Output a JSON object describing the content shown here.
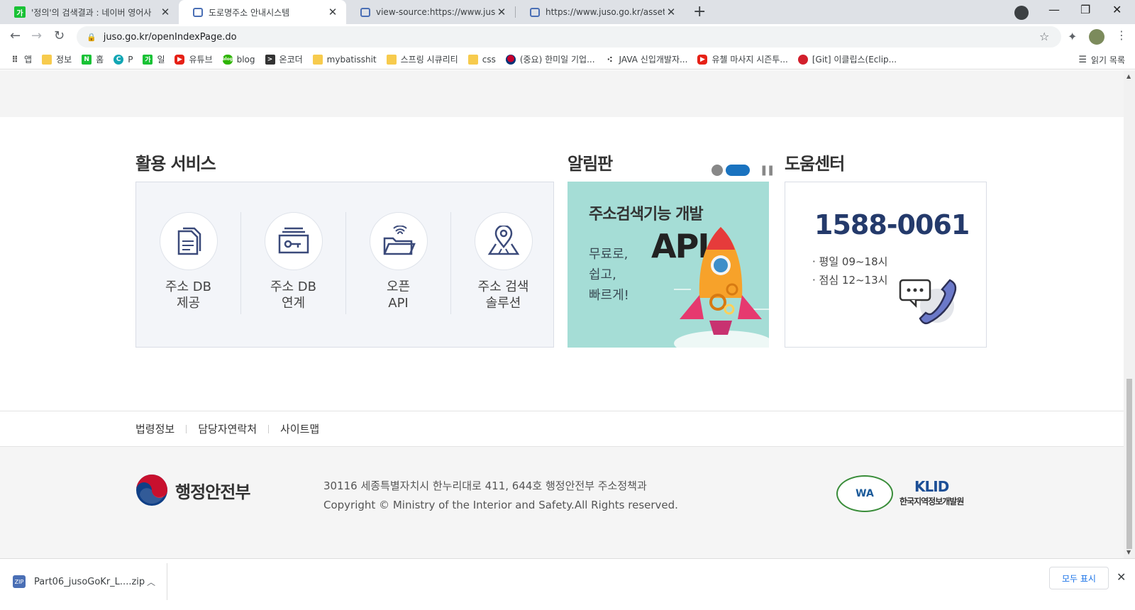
{
  "browser": {
    "tabs": [
      {
        "title": "'정의'의 검색결과 : 네이버 영어사",
        "favicon": "naver-icon",
        "active": false
      },
      {
        "title": "도로명주소 안내시스템",
        "favicon": "page-icon",
        "active": true
      },
      {
        "title": "view-source:https://www.juso.go",
        "favicon": "page-icon",
        "active": false
      },
      {
        "title": "https://www.juso.go.kr/assets/cs",
        "favicon": "page-icon",
        "active": false
      }
    ],
    "url": "juso.go.kr/openIndexPage.do",
    "bookmarks": [
      {
        "label": "앱",
        "icon": "apps-grid-icon"
      },
      {
        "label": "정보",
        "icon": "folder-icon"
      },
      {
        "label": "홈",
        "icon": "naver-n-icon"
      },
      {
        "label": "P",
        "icon": "p-icon"
      },
      {
        "label": "일",
        "icon": "naver-ga-icon"
      },
      {
        "label": "유튜브",
        "icon": "youtube-icon"
      },
      {
        "label": "blog",
        "icon": "blog-icon"
      },
      {
        "label": "온코더",
        "icon": "terminal-icon"
      },
      {
        "label": "mybatisshit",
        "icon": "folder-icon"
      },
      {
        "label": "스프링 시큐리티",
        "icon": "folder-icon"
      },
      {
        "label": "css",
        "icon": "folder-icon"
      },
      {
        "label": "(중요) 한미일 기업...",
        "icon": "flag-icon"
      },
      {
        "label": "JAVA 신입개발자...",
        "icon": "dots-icon"
      },
      {
        "label": "유첼 마사지 시즌투...",
        "icon": "youtube-icon"
      },
      {
        "label": "[Git] 이클립스(Eclip...",
        "icon": "apple-icon"
      }
    ],
    "reading_list": "읽기 목록"
  },
  "page": {
    "services_title": "활용 서비스",
    "services": [
      {
        "line1": "주소 DB",
        "line2": "제공",
        "icon": "document-icon"
      },
      {
        "line1": "주소 DB",
        "line2": "연계",
        "icon": "database-key-icon"
      },
      {
        "line1": "오픈",
        "line2": "API",
        "icon": "open-folder-icon"
      },
      {
        "line1": "주소 검색",
        "line2": "솔루션",
        "icon": "map-pin-icon"
      }
    ],
    "notice_title": "알림판",
    "notice_banner": {
      "title": "주소검색기능 개발",
      "sub1": "무료로,",
      "sub2": "쉽고,",
      "sub3": "빠르게!",
      "big": "API"
    },
    "help_title": "도움센터",
    "help": {
      "phone": "1588-0061",
      "weekday": "· 평일 09~18시",
      "lunch": "· 점심 12~13시"
    },
    "footer_links": [
      "법령정보",
      "담당자연락처",
      "사이트맵"
    ],
    "footer": {
      "org": "행정안전부",
      "address": "30116 세종특별자치시 한누리대로 411, 644호 행정안전부 주소정책과",
      "copyright": "Copyright © Ministry of the Interior and Safety.All Rights reserved.",
      "wa_badge": "WA",
      "klid_logo": "KLID",
      "klid_name": "한국지역정보개발원"
    }
  },
  "downloads": {
    "file": "Part06_jusoGoKr_L....zip",
    "show_all": "모두 표시"
  },
  "colors": {
    "accent": "#1a73c0",
    "phone": "#243a6b",
    "banner_bg": "#a5ddd6",
    "icon_navy": "#3b4a7a"
  }
}
